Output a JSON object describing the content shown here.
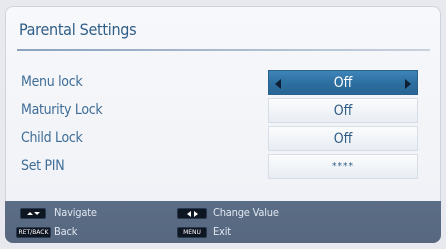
{
  "title": "Parental Settings",
  "settings": [
    {
      "label": "Menu lock",
      "value": "Off",
      "selected": true
    },
    {
      "label": "Maturity Lock",
      "value": "Off",
      "selected": false
    },
    {
      "label": "Child Lock",
      "value": "Off",
      "selected": false
    },
    {
      "label": "Set PIN",
      "value": "****",
      "selected": false
    }
  ],
  "footer": {
    "navigate_label": "Navigate",
    "change_value_label": "Change Value",
    "back_key": "RET/BACK",
    "back_label": "Back",
    "menu_key": "MENU",
    "exit_label": "Exit"
  },
  "colors": {
    "accent": "#2f5d86",
    "selected_row": "#2f75aa",
    "footer_bg": "#5a6b84"
  }
}
